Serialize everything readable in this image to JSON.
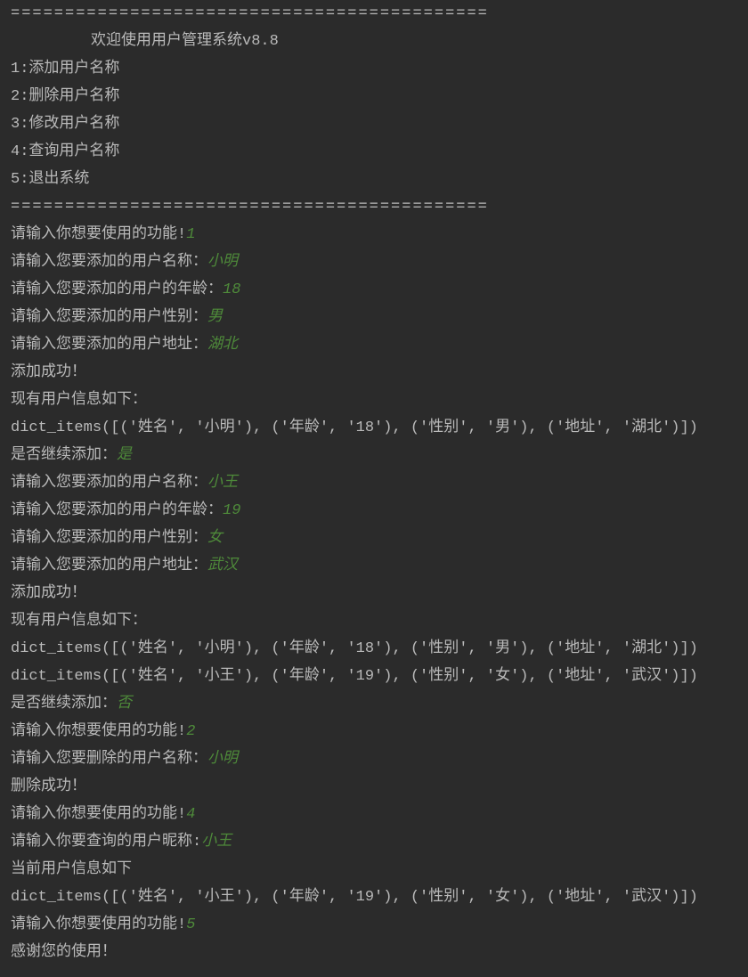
{
  "divider_top": "============================================",
  "title": "欢迎使用用户管理系统v8.8",
  "menu": {
    "item1": "1:添加用户名称",
    "item2": "2:删除用户名称",
    "item3": "3:修改用户名称",
    "item4": "4:查询用户名称",
    "item5": "5:退出系统"
  },
  "divider_mid": "============================================",
  "session": {
    "p_func": "请输入你想要使用的功能!",
    "v_func1": "1",
    "p_add_name": "请输入您要添加的用户名称：",
    "v_add_name1": "小明",
    "p_add_age": "请输入您要添加的用户的年龄：",
    "v_add_age1": "18",
    "p_add_gender": "请输入您要添加的用户性别：",
    "v_add_gender1": "男",
    "p_add_addr": "请输入您要添加的用户地址：",
    "v_add_addr1": "湖北",
    "add_ok": "添加成功！",
    "cur_header": "现有用户信息如下：",
    "dict1": "dict_items([('姓名', '小明'), ('年龄', '18'), ('性别', '男'), ('地址', '湖北')])",
    "p_continue": "是否继续添加：",
    "v_continue1": "是",
    "v_add_name2": "小王",
    "v_add_age2": "19",
    "v_add_gender2": "女",
    "v_add_addr2": "武汉",
    "dict2a": "dict_items([('姓名', '小明'), ('年龄', '18'), ('性别', '男'), ('地址', '湖北')])",
    "dict2b": "dict_items([('姓名', '小王'), ('年龄', '19'), ('性别', '女'), ('地址', '武汉')])",
    "v_continue2": "否",
    "v_func2": "2",
    "p_del_name": "请输入您要删除的用户名称：",
    "v_del_name": "小明",
    "del_ok": "删除成功！",
    "v_func4": "4",
    "p_query_name": "请输入你要查询的用户昵称:",
    "v_query_name": "小王",
    "query_header": "当前用户信息如下",
    "dict3": "dict_items([('姓名', '小王'), ('年龄', '19'), ('性别', '女'), ('地址', '武汉')])",
    "v_func5": "5",
    "thanks": "感谢您的使用！"
  }
}
